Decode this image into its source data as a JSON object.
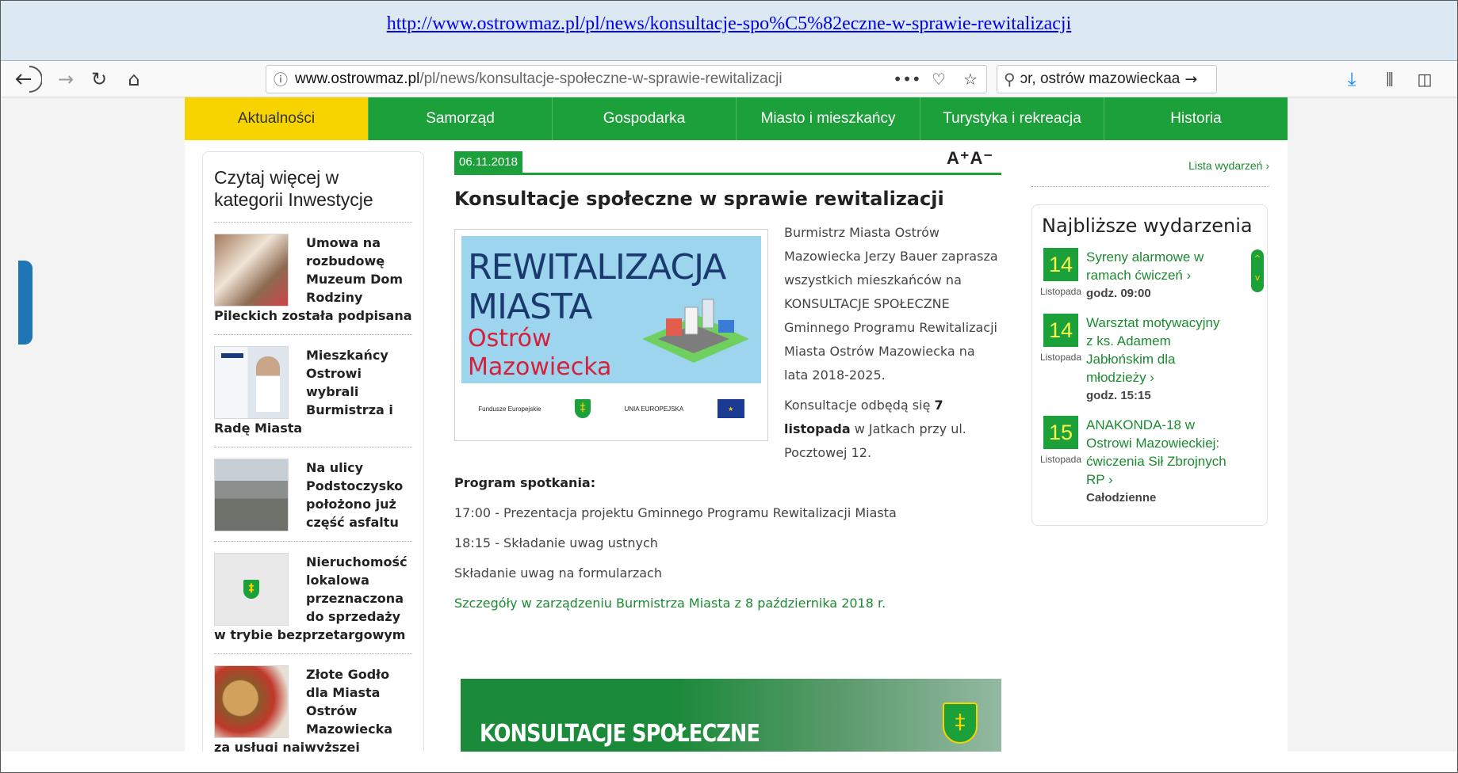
{
  "caption": {
    "link_text": "http://www.ostrowmaz.pl/pl/news/konsultacje-spo%C5%82eczne-w-sprawie-rewitalizacji"
  },
  "browser": {
    "url_domain": "www.ostrowmaz.pl",
    "url_path": "/pl/news/konsultacje-społeczne-w-sprawie-rewitalizacji",
    "search_text": "ɔr, ostrów mazowieckaa",
    "icons": [
      "back-icon",
      "forward-icon",
      "reload-icon",
      "home-icon",
      "info-icon",
      "more-icon",
      "pocket-icon",
      "star-icon",
      "search-icon",
      "download-icon",
      "library-icon",
      "sidebar-icon"
    ]
  },
  "nav": {
    "items": [
      {
        "label": "Aktualności",
        "active": true
      },
      {
        "label": "Samorząd"
      },
      {
        "label": "Gospodarka"
      },
      {
        "label": "Miasto i mieszkańcy"
      },
      {
        "label": "Turystyka i rekreacja"
      },
      {
        "label": "Historia"
      }
    ],
    "colors": {
      "bar": "#1ca03a",
      "active": "#f7d400"
    }
  },
  "left": {
    "heading": "Czytaj więcej w kategorii Inwestycje",
    "items": [
      {
        "title": "Umowa na rozbudowę Muzeum Dom Rodziny Pileckich została podpisana"
      },
      {
        "title": "Mieszkańcy Ostrowi wybrali Burmistrza i Radę Miasta"
      },
      {
        "title": "Na ulicy Podstoczysko położono już część asfaltu"
      },
      {
        "title": "Nieruchomość lokalowa przeznaczona do sprzedaży w trybie bezprzetargowym"
      },
      {
        "title": "Złote Godło dla Miasta Ostrów Mazowiecka za usługi najwyższej jakości"
      }
    ]
  },
  "article": {
    "font_size_control": "A⁺A⁻",
    "date": "06.11.2018",
    "title": "Konsultacje społeczne w sprawie rewitalizacji",
    "hero": {
      "line1": "REWITALIZACJA",
      "line2": "MIASTA",
      "line3": "Ostrów",
      "line4": "Mazowiecka",
      "logo_left": "Fundusze Europejskie",
      "logo_right": "UNIA EUROPEJSKA"
    },
    "intro": "Burmistrz Miasta Ostrów Mazowiecka Jerzy Bauer zaprasza wszystkich mieszkańców na KONSULTACJE SPOŁECZNE Gminnego Programu Rewitalizacji Miasta Ostrów Mazowiecka na lata 2018-2025.",
    "meeting_pre": "Konsultacje odbędą się ",
    "meeting_date": "7 listopada",
    "meeting_post": " w Jatkach przy ul. Pocztowej 12.",
    "program_heading": "Program spotkania:",
    "program_1": "17:00 - Prezentacja projektu Gminnego Programu Rewitalizacji Miasta",
    "program_2": "18:15 - Składanie uwag ustnych",
    "program_3": "Składanie uwag na formularzach",
    "details_link": "Szczegóły w zarządzeniu Burmistrza Miasta z 8 października 2018 r.",
    "banner_text": "KONSULTACJE SPOŁECZNE"
  },
  "right": {
    "events_link": "Lista wydarzeń ›",
    "events_heading": "Najbliższe wydarzenia",
    "events": [
      {
        "day": "14",
        "month": "Listopada",
        "title": "Syreny alarmowe w ramach ćwiczeń ›",
        "time": "godz. 09:00"
      },
      {
        "day": "14",
        "month": "Listopada",
        "title": "Warsztat motywacyjny z ks. Adamem Jabłońskim dla młodzieży ›",
        "time": "godz. 15:15"
      },
      {
        "day": "15",
        "month": "Listopada",
        "title": "ANAKONDA-18 w Ostrowi Mazowieckiej: ćwiczenia Sił Zbrojnych RP ›",
        "time": "Całodzienne"
      }
    ]
  }
}
